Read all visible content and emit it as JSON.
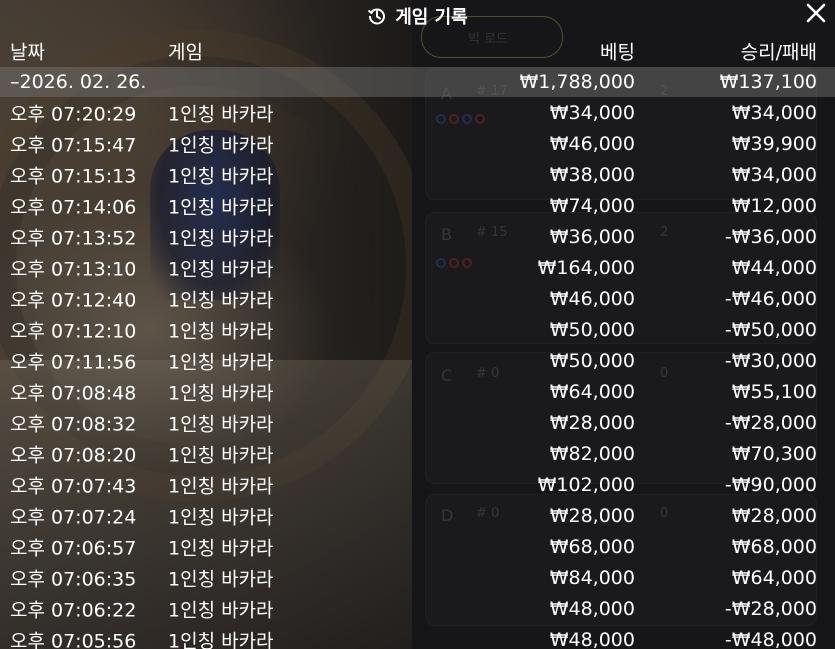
{
  "title": "게임 기록",
  "columns": {
    "date": "날짜",
    "game": "게임",
    "bet": "베팅",
    "result": "승리/패배"
  },
  "summary": {
    "date": "–2026. 02. 26.",
    "bet": "₩1,788,000",
    "result": "₩137,100"
  },
  "rows": [
    {
      "time": "오후 07:20:29",
      "game": "1인칭 바카라",
      "bet": "₩34,000",
      "result": "₩34,000"
    },
    {
      "time": "오후 07:15:47",
      "game": "1인칭 바카라",
      "bet": "₩46,000",
      "result": "₩39,900"
    },
    {
      "time": "오후 07:15:13",
      "game": "1인칭 바카라",
      "bet": "₩38,000",
      "result": "₩34,000"
    },
    {
      "time": "오후 07:14:06",
      "game": "1인칭 바카라",
      "bet": "₩74,000",
      "result": "₩12,000"
    },
    {
      "time": "오후 07:13:52",
      "game": "1인칭 바카라",
      "bet": "₩36,000",
      "result": "-₩36,000"
    },
    {
      "time": "오후 07:13:10",
      "game": "1인칭 바카라",
      "bet": "₩164,000",
      "result": "₩44,000"
    },
    {
      "time": "오후 07:12:40",
      "game": "1인칭 바카라",
      "bet": "₩46,000",
      "result": "-₩46,000"
    },
    {
      "time": "오후 07:12:10",
      "game": "1인칭 바카라",
      "bet": "₩50,000",
      "result": "-₩50,000"
    },
    {
      "time": "오후 07:11:56",
      "game": "1인칭 바카라",
      "bet": "₩50,000",
      "result": "-₩30,000"
    },
    {
      "time": "오후 07:08:48",
      "game": "1인칭 바카라",
      "bet": "₩64,000",
      "result": "₩55,100"
    },
    {
      "time": "오후 07:08:32",
      "game": "1인칭 바카라",
      "bet": "₩28,000",
      "result": "-₩28,000"
    },
    {
      "time": "오후 07:08:20",
      "game": "1인칭 바카라",
      "bet": "₩82,000",
      "result": "₩70,300"
    },
    {
      "time": "오후 07:07:43",
      "game": "1인칭 바카라",
      "bet": "₩102,000",
      "result": "-₩90,000"
    },
    {
      "time": "오후 07:07:24",
      "game": "1인칭 바카라",
      "bet": "₩28,000",
      "result": "₩28,000"
    },
    {
      "time": "오후 07:06:57",
      "game": "1인칭 바카라",
      "bet": "₩68,000",
      "result": "₩68,000"
    },
    {
      "time": "오후 07:06:35",
      "game": "1인칭 바카라",
      "bet": "₩84,000",
      "result": "₩64,000"
    },
    {
      "time": "오후 07:06:22",
      "game": "1인칭 바카라",
      "bet": "₩48,000",
      "result": "-₩28,000"
    },
    {
      "time": "오후 07:05:56",
      "game": "1인칭 바카라",
      "bet": "₩48,000",
      "result": "-₩48,000"
    }
  ],
  "background": {
    "road_dropdown": "빅 로드",
    "tables": [
      {
        "label": "A",
        "count": "# 17",
        "extra": "2"
      },
      {
        "label": "B",
        "count": "# 15",
        "extra": "2"
      },
      {
        "label": "C",
        "count": "# 0",
        "extra": "0"
      },
      {
        "label": "D",
        "count": "# 0",
        "extra": "0"
      }
    ]
  },
  "icons": {
    "history": "history-icon",
    "close": "close-icon"
  },
  "colors": {
    "text": "#ffffff",
    "summary_bg": "rgba(120,120,120,0.45)",
    "overlay": "rgba(10,10,12,0.42)"
  }
}
